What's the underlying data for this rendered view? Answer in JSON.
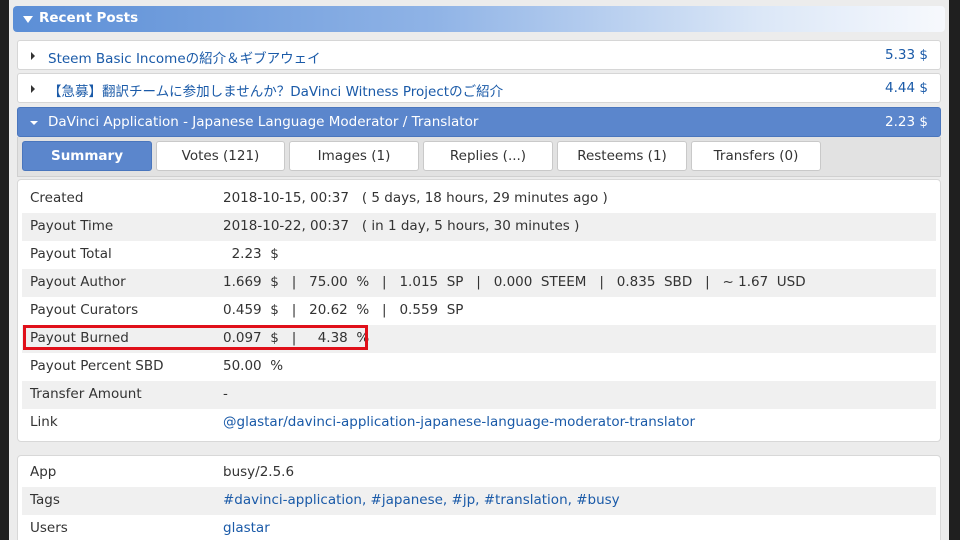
{
  "header": {
    "title": "Recent Posts"
  },
  "posts": [
    {
      "title": "Steem Basic Incomeの紹介＆ギブアウェイ",
      "value": "5.33 $"
    },
    {
      "title": "【急募】翻訳チームに参加しませんか？DaVinci Witness Projectのご紹介",
      "value": "4.44 $"
    },
    {
      "title": "DaVinci Application - Japanese Language Moderator / Translator",
      "value": "2.23 $"
    }
  ],
  "tabs": [
    {
      "label": "Summary"
    },
    {
      "label": "Votes (121)"
    },
    {
      "label": "Images (1)"
    },
    {
      "label": "Replies (...)"
    },
    {
      "label": "Resteems (1)"
    },
    {
      "label": "Transfers (0)"
    }
  ],
  "summary": [
    {
      "key": "Created",
      "value": "2018-10-15, 00:37   ( 5 days, 18 hours, 29 minutes ago )"
    },
    {
      "key": "Payout Time",
      "value": "2018-10-22, 00:37   ( in 1 day, 5 hours, 30 minutes )"
    },
    {
      "key": "Payout Total",
      "value": "  2.23  $"
    },
    {
      "key": "Payout Author",
      "value": "1.669  $   |   75.00  %   |   1.015  SP   |   0.000  STEEM   |   0.835  SBD   |   ~ 1.67  USD"
    },
    {
      "key": "Payout Curators",
      "value": "0.459  $   |   20.62  %   |   0.559  SP"
    },
    {
      "key": "Payout Burned",
      "value": "0.097  $   |     4.38  %"
    },
    {
      "key": "Payout Percent SBD",
      "value": "50.00  %"
    },
    {
      "key": "Transfer Amount",
      "value": "-"
    },
    {
      "key": "Link",
      "value": "@glastar/davinci-application-japanese-language-moderator-translator"
    }
  ],
  "meta": [
    {
      "key": "App",
      "value": "busy/2.5.6"
    },
    {
      "key": "Tags",
      "value": "#davinci-application, #japanese, #jp, #translation, #busy"
    },
    {
      "key": "Users",
      "value": "glastar"
    }
  ]
}
